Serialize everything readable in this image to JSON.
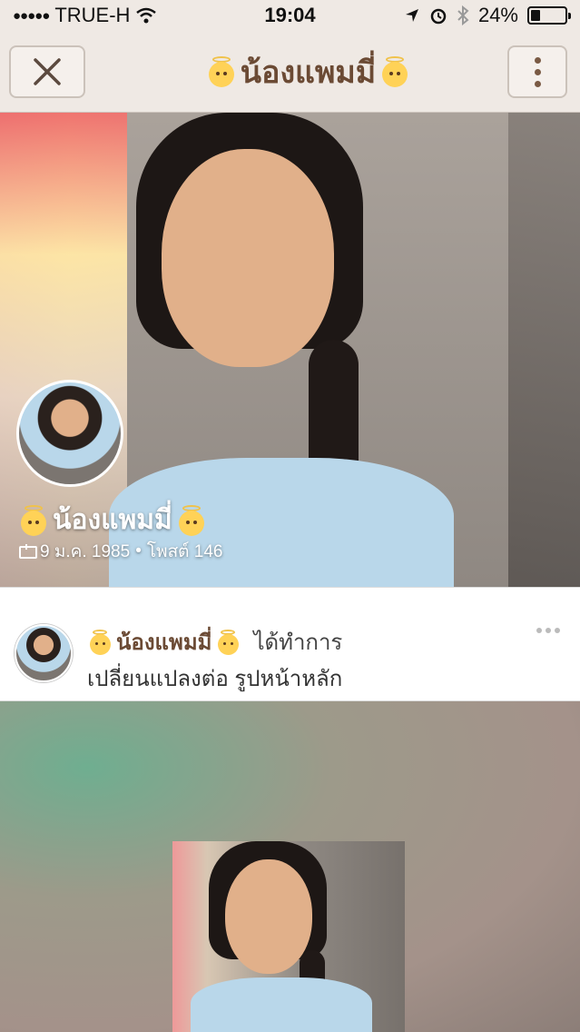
{
  "status_bar": {
    "carrier": "TRUE-H",
    "time": "19:04",
    "battery": "24%",
    "battery_level": 0.24,
    "icons": [
      "signal-dots-icon",
      "wifi-icon",
      "location-arrow-icon",
      "alarm-icon",
      "bluetooth-icon",
      "battery-icon"
    ]
  },
  "header": {
    "title": "น้องแพมมี่",
    "close_icon": "close-icon",
    "more_icon": "more-vertical-icon"
  },
  "profile": {
    "name": "น้องแพมมี่",
    "birthday": "9 ม.ค. 1985",
    "separator": "•",
    "posts": "โพสต์ 146"
  },
  "post": {
    "author": "น้องแพมมี่",
    "action": "ได้ทำการ",
    "description": "เปลี่ยนแปลงต่อ รูปหน้าหลัก"
  },
  "colors": {
    "header_bg": "#efe9e4",
    "title_brown": "#6b4a34"
  }
}
